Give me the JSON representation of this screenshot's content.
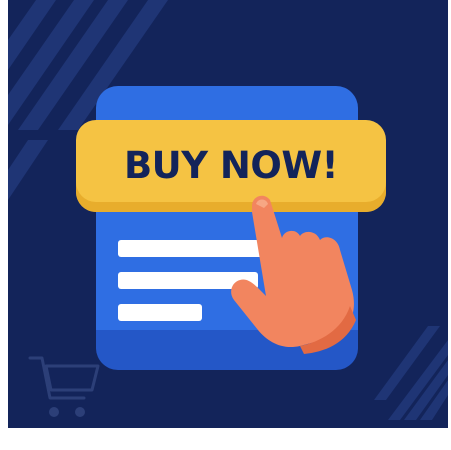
{
  "banner": {
    "label": "BUY NOW!"
  },
  "colors": {
    "background": "#13245a",
    "card": "#2f6ee3",
    "banner": "#f5c343",
    "hand": "#f2855f",
    "text": "#13245a"
  },
  "icons": [
    "shopping-cart-icon",
    "pointing-hand-icon"
  ]
}
